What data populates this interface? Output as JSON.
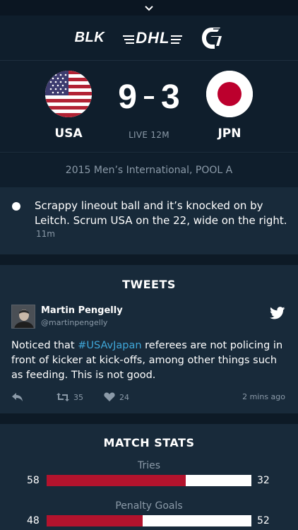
{
  "header": {
    "chevron": "chevron-down-icon"
  },
  "sponsors": {
    "logo1": "BLK",
    "logo2": "DHL",
    "logo3": "G"
  },
  "match": {
    "home": {
      "name": "USA",
      "flag": "usa-flag"
    },
    "away": {
      "name": "JPN",
      "flag": "japan-flag"
    },
    "home_score": "9",
    "away_score": "3",
    "status": "LIVE 12M",
    "competition": "2015 Men’s International, POOL A"
  },
  "commentary": {
    "text": "Scrappy lineout ball and it’s knocked on by Leitch. Scrum USA on the 22, wide on the right.",
    "time": "11m"
  },
  "tweets": {
    "title": "TWEETS",
    "author_name": "Martin Pengelly",
    "author_handle": "@martinpengelly",
    "body_before": "Noticed that ",
    "hashtag": "#USAvJapan",
    "body_after": " referees are not policing in front of kicker at kick-offs, among other things such as feeding. This is not good.",
    "retweets": "35",
    "likes": "24",
    "time": "2 mins ago",
    "hashtag_color": "#3fa7d9"
  },
  "stats": {
    "title": "MATCH STATS",
    "items": [
      {
        "label": "Tries",
        "home": "58",
        "away": "32",
        "home_fraction": 0.68
      },
      {
        "label": "Penalty Goals",
        "home": "48",
        "away": "52",
        "home_fraction": 0.47
      }
    ],
    "home_color": "#b3132d",
    "away_color": "#ffffff"
  }
}
